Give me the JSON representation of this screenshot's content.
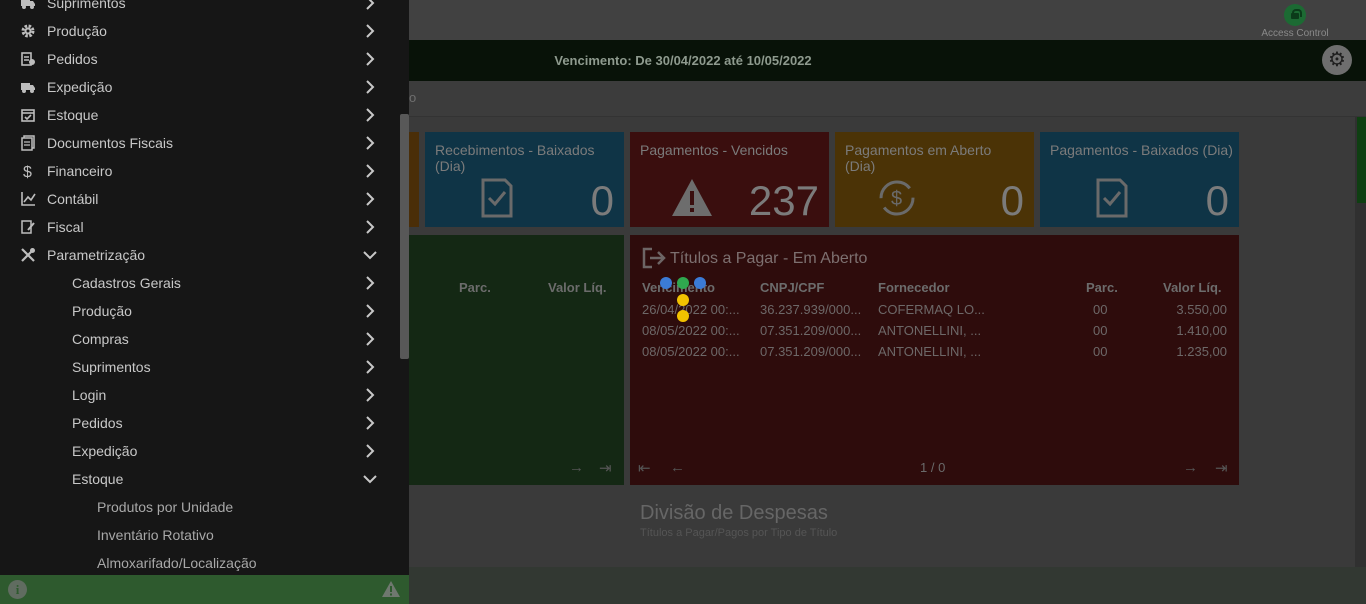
{
  "header": {
    "access_control": "Access Control",
    "vencimento": "Vencimento: De 30/04/2022 até 10/05/2022",
    "breadcrumb_tail": "o"
  },
  "cards": [
    {
      "title": "",
      "value": "",
      "color": "#4a2e08"
    },
    {
      "title": "Recebimentos - Baixados (Dia)",
      "value": "0",
      "color": "#0f3446"
    },
    {
      "title": "Pagamentos - Vencidos",
      "value": "237",
      "color": "#3a0e0e"
    },
    {
      "title": "Pagamentos em Aberto (Dia)",
      "value": "0",
      "color": "#4b3306"
    },
    {
      "title": "Pagamentos - Baixados (Dia)",
      "value": "0",
      "color": "#0f3446"
    }
  ],
  "panel_green": {
    "col_parc": "Parc.",
    "col_valor": "Valor Líq."
  },
  "panel_red": {
    "title": "Títulos a Pagar - Em Aberto",
    "columns": [
      "Vencimento",
      "CNPJ/CPF",
      "Fornecedor",
      "Parc.",
      "Valor Líq."
    ],
    "rows": [
      [
        "26/04/2022 00:...",
        "36.237.939/000...",
        "COFERMAQ LO...",
        "00",
        "3.550,00"
      ],
      [
        "08/05/2022 00:...",
        "07.351.209/000...",
        "ANTONELLINI, ...",
        "00",
        "1.410,00"
      ],
      [
        "08/05/2022 00:...",
        "07.351.209/000...",
        "ANTONELLINI, ...",
        "00",
        "1.235,00"
      ]
    ],
    "page": "1 / 0"
  },
  "divisao": {
    "title": "Divisão de Despesas",
    "subtitle": "Títulos a Pagar/Pagos por Tipo de Título"
  },
  "sidebar": {
    "items": [
      {
        "label": "Suprimentos",
        "icon": "truck-icon",
        "expanded": false
      },
      {
        "label": "Produção",
        "icon": "gear-icon",
        "expanded": false
      },
      {
        "label": "Pedidos",
        "icon": "clipboard-icon",
        "expanded": false
      },
      {
        "label": "Expedição",
        "icon": "truck-icon",
        "expanded": false
      },
      {
        "label": "Estoque",
        "icon": "box-check-icon",
        "expanded": false
      },
      {
        "label": "Documentos Fiscais",
        "icon": "documents-icon",
        "expanded": false
      },
      {
        "label": "Financeiro",
        "icon": "dollar-icon",
        "expanded": false
      },
      {
        "label": "Contábil",
        "icon": "chart-line-icon",
        "expanded": false
      },
      {
        "label": "Fiscal",
        "icon": "edit-doc-icon",
        "expanded": false
      },
      {
        "label": "Parametrização",
        "icon": "tools-icon",
        "expanded": true
      }
    ],
    "sub_items": [
      {
        "label": "Cadastros Gerais",
        "expanded": false
      },
      {
        "label": "Produção",
        "expanded": false
      },
      {
        "label": "Compras",
        "expanded": false
      },
      {
        "label": "Suprimentos",
        "expanded": false
      },
      {
        "label": "Login",
        "expanded": false
      },
      {
        "label": "Pedidos",
        "expanded": false
      },
      {
        "label": "Expedição",
        "expanded": false
      },
      {
        "label": "Estoque",
        "expanded": true
      }
    ],
    "sub_sub_items": [
      {
        "label": "Produtos por Unidade"
      },
      {
        "label": "Inventário Rotativo"
      },
      {
        "label": "Almoxarifado/Localização"
      }
    ]
  },
  "colors": {
    "sidebar_bg": "#161616",
    "bottom_bar": "#2e5a2e",
    "loader_blue": "#3b7bd6",
    "loader_green": "#2fa84f",
    "loader_yellow": "#f2c200"
  }
}
